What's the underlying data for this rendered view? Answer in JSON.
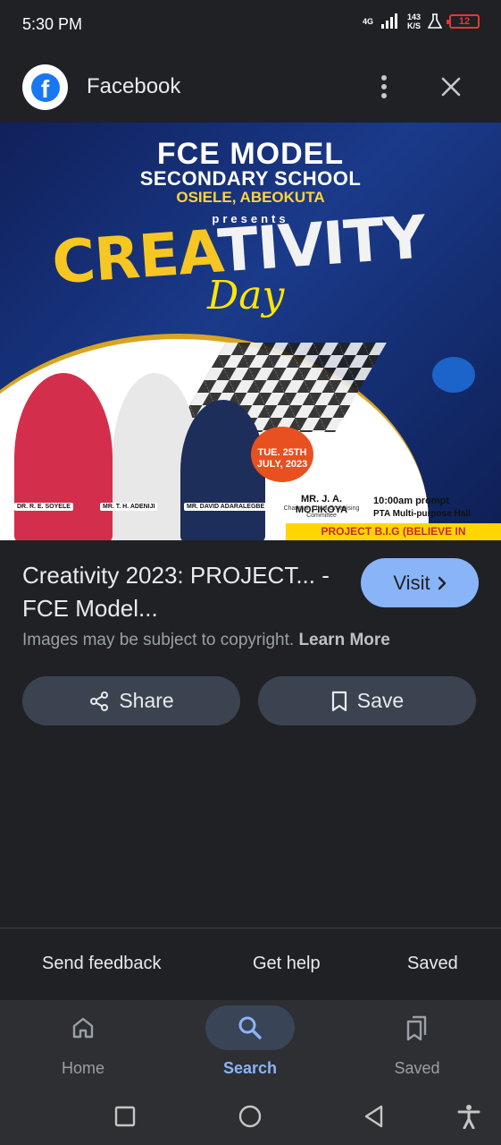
{
  "status_bar": {
    "time": "5:30 PM",
    "network": "4G",
    "speed_value": "143",
    "speed_unit": "K/S",
    "battery": "12",
    "battery_color": "#e53935"
  },
  "app_bar": {
    "title": "Facebook",
    "logo_letter": "f",
    "logo_icon": "facebook-logo-icon",
    "more_icon": "more-vert-icon",
    "close_icon": "close-icon"
  },
  "hero": {
    "title": "FCE MODEL",
    "subtitle": "SECONDARY SCHOOL",
    "location": "OSIELE, ABEOKUTA",
    "presents": "presents",
    "headline_a": "CREA",
    "headline_b": "TIVITY",
    "headline_day": "Day",
    "date_line1": "TUE. 25TH",
    "date_line2": "JULY, 2023",
    "person1": "DR. R. E. SOYELE",
    "person2": "MR. T. H. ADENIJI",
    "person3": "MR. DAVID ADARALEGBE",
    "chairman_name": "MR. J. A. MOFIKOYA",
    "chairman_role": "Chairman Local Organising Committee",
    "time": "10:00am prompt",
    "venue": "PTA Multi-purpose Hall",
    "project": "PROJECT B.I.G (BELIEVE IN GREATNESS)",
    "lens_icon": "google-lens-icon"
  },
  "result": {
    "title": "Creativity 2023: PROJECT... - FCE Model...",
    "visit_label": "Visit",
    "copyright_text": "Images may be subject to copyright.",
    "learn_more": "Learn More"
  },
  "actions": {
    "share_label": "Share",
    "save_label": "Save"
  },
  "footer": {
    "send_feedback": "Send feedback",
    "get_help": "Get help",
    "saved": "Saved"
  },
  "bottom_nav": {
    "items": [
      {
        "label": "Home",
        "icon": "home-icon"
      },
      {
        "label": "Search",
        "icon": "search-icon"
      },
      {
        "label": "Saved",
        "icon": "bookmarks-icon"
      }
    ],
    "active_color": "#8ab4f8"
  }
}
